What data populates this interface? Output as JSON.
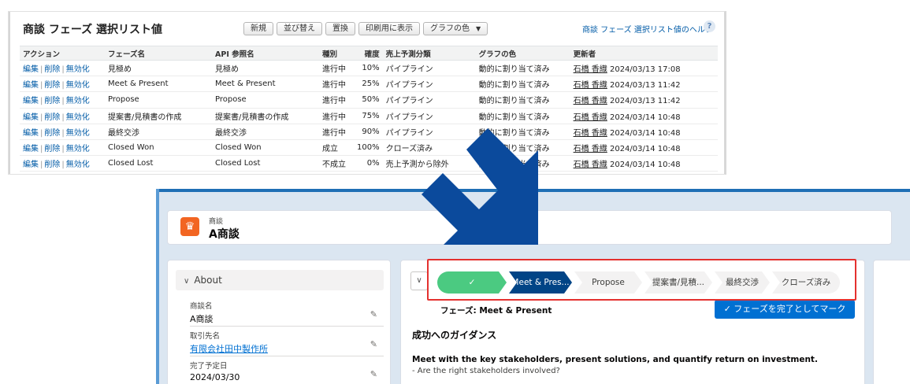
{
  "picklist_panel": {
    "title": "商談 フェーズ 選択リスト値",
    "toolbar": {
      "new": "新規",
      "reorder": "並び替え",
      "replace": "置換",
      "printable": "印刷用に表示",
      "chart_colors": "グラフの色"
    },
    "help_link": "商談 フェーズ 選択リスト値のヘルプ",
    "help_icon": "?",
    "columns": {
      "action": "アクション",
      "phase_name": "フェーズ名",
      "api_name": "API 参照名",
      "type": "種別",
      "probability": "確度",
      "forecast": "売上予測分類",
      "chart_color": "グラフの色",
      "modified_by": "更新者"
    },
    "action_labels": {
      "edit": "編集",
      "delete": "削除",
      "deactivate": "無効化",
      "sep": "|"
    },
    "rows": [
      {
        "name": "見極め",
        "api": "見極め",
        "type": "進行中",
        "prob": "10%",
        "forecast": "パイプライン",
        "color": "動的に割り当て済み",
        "user": "石橋 香織",
        "date": "2024/03/13 17:08"
      },
      {
        "name": "Meet & Present",
        "api": "Meet & Present",
        "type": "進行中",
        "prob": "25%",
        "forecast": "パイプライン",
        "color": "動的に割り当て済み",
        "user": "石橋 香織",
        "date": "2024/03/13 11:42"
      },
      {
        "name": "Propose",
        "api": "Propose",
        "type": "進行中",
        "prob": "50%",
        "forecast": "パイプライン",
        "color": "動的に割り当て済み",
        "user": "石橋 香織",
        "date": "2024/03/13 11:42"
      },
      {
        "name": "提案書/見積書の作成",
        "api": "提案書/見積書の作成",
        "type": "進行中",
        "prob": "75%",
        "forecast": "パイプライン",
        "color": "動的に割り当て済み",
        "user": "石橋 香織",
        "date": "2024/03/14 10:48"
      },
      {
        "name": "最終交渉",
        "api": "最終交渉",
        "type": "進行中",
        "prob": "90%",
        "forecast": "パイプライン",
        "color": "動的に割り当て済み",
        "user": "石橋 香織",
        "date": "2024/03/14 10:48"
      },
      {
        "name": "Closed Won",
        "api": "Closed Won",
        "type": "成立",
        "prob": "100%",
        "forecast": "クローズ済み",
        "color": "動的に割り当て済み",
        "user": "石橋 香織",
        "date": "2024/03/14 10:48"
      },
      {
        "name": "Closed Lost",
        "api": "Closed Lost",
        "type": "不成立",
        "prob": "0%",
        "forecast": "売上予測から除外",
        "color": "動的に割り当て済み",
        "user": "石橋 香織",
        "date": "2024/03/14 10:48"
      }
    ]
  },
  "record": {
    "object_type": "商談",
    "record_name": "A商談",
    "object_icon": "crown-icon",
    "about_label": "About",
    "fields": [
      {
        "label": "商談名",
        "value": "A商談",
        "link": false
      },
      {
        "label": "取引先名",
        "value": "有限会社田中製作所",
        "link": true
      },
      {
        "label": "完了予定日",
        "value": "2024/03/30",
        "link": false
      }
    ],
    "path_steps": [
      {
        "label": "✓",
        "state": "done"
      },
      {
        "label": "Meet & Pres...",
        "state": "current"
      },
      {
        "label": "Propose",
        "state": "todo"
      },
      {
        "label": "提案書/見積...",
        "state": "todo"
      },
      {
        "label": "最終交渉",
        "state": "todo"
      },
      {
        "label": "クローズ済み",
        "state": "todo"
      }
    ],
    "phase_label": "フェーズ: Meet & Present",
    "complete_button": "フェーズを完了としてマーク",
    "guidance_title": "成功へのガイダンス",
    "guidance_main": "Meet with the key stakeholders, present solutions, and quantify return on investment.",
    "guidance_sub": "- Are the right stakeholders involved?"
  },
  "colors": {
    "arrow": "#0b4a9c",
    "highlight": "#e4312f",
    "path_done": "#4bca81",
    "path_current": "#014486",
    "button": "#0070d2"
  }
}
